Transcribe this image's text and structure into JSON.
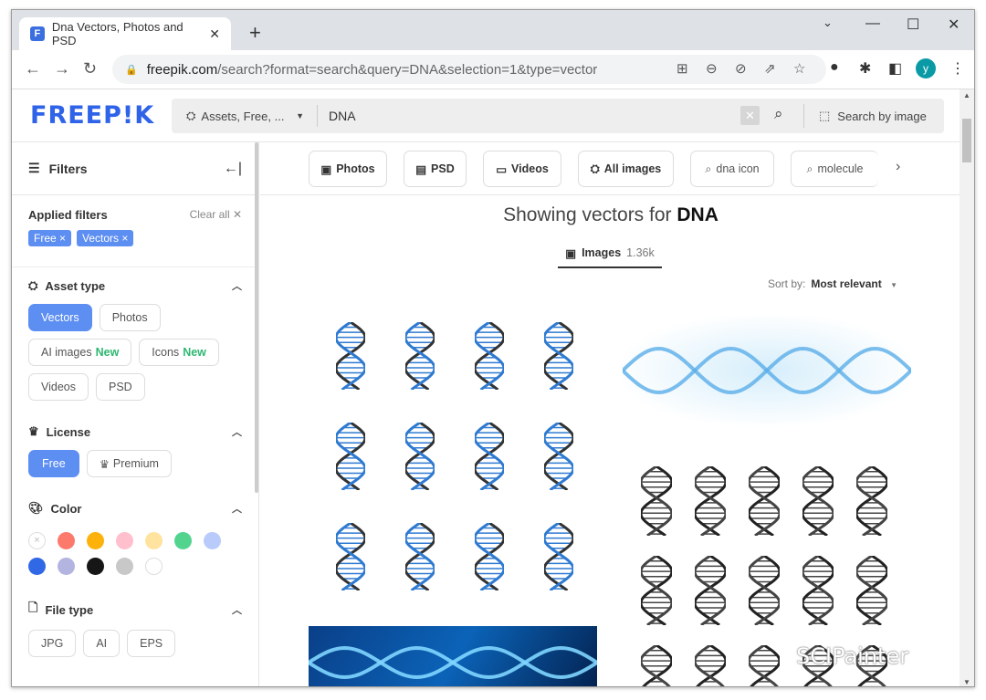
{
  "browser": {
    "tab_title": "Dna Vectors, Photos and PSD",
    "url_domain": "freepik.com",
    "url_path": "/search?format=search&query=DNA&selection=1&type=vector",
    "avatar_letter": "y"
  },
  "header": {
    "logo": "FREEPIK",
    "logo_display": "FREEP!K",
    "scope": "Assets, Free, ...",
    "query": "DNA",
    "search_by_image": "Search by image"
  },
  "sidebar": {
    "title": "Filters",
    "applied_label": "Applied filters",
    "clear_all": "Clear all",
    "applied": [
      "Free",
      "Vectors"
    ],
    "asset_type": {
      "label": "Asset type",
      "options": [
        {
          "label": "Vectors",
          "selected": true
        },
        {
          "label": "Photos"
        },
        {
          "label": "AI images",
          "badge": "New"
        },
        {
          "label": "Icons",
          "badge": "New"
        },
        {
          "label": "Videos"
        },
        {
          "label": "PSD"
        }
      ]
    },
    "license": {
      "label": "License",
      "options": [
        {
          "label": "Free",
          "selected": true
        },
        {
          "label": "Premium"
        }
      ]
    },
    "color": {
      "label": "Color",
      "swatches": [
        "none",
        "#fb7a6b",
        "#fdb10b",
        "#ffbfcd",
        "#ffe39e",
        "#52d48f",
        "#b8cbfb",
        "#3068e5",
        "#b4b4e0",
        "#161616",
        "#c8c8c8",
        "#ffffff"
      ]
    },
    "file_type": {
      "label": "File type",
      "options": [
        "JPG",
        "AI",
        "EPS"
      ]
    }
  },
  "categories": [
    {
      "label": "Photos",
      "icon": "photo-icon"
    },
    {
      "label": "PSD",
      "icon": "psd-icon"
    },
    {
      "label": "Videos",
      "icon": "video-icon"
    },
    {
      "label": "All images",
      "icon": "shapes-icon"
    },
    {
      "label": "dna icon",
      "icon": "search-icon"
    },
    {
      "label": "molecule",
      "icon": "search-icon"
    }
  ],
  "results": {
    "prefix": "Showing vectors for",
    "query": "DNA",
    "tab_label": "Images",
    "tab_count": "1.36k",
    "sort_label": "Sort by:",
    "sort_value": "Most relevant"
  },
  "watermark": "SCIPainter",
  "colors": {
    "accent": "#5d8ef2",
    "logo": "#2f63e8",
    "new_badge": "#2eb872"
  }
}
